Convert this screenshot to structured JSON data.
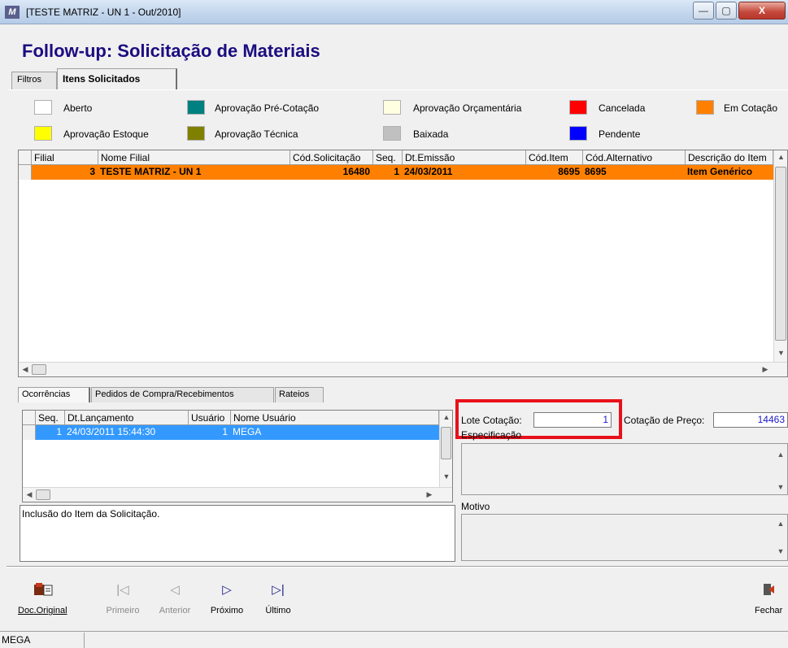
{
  "window": {
    "title": "[TESTE MATRIZ - UN 1 - Out/2010]",
    "app_icon": "app-logo-icon",
    "buttons": {
      "minimize": "—",
      "maximize": "▢",
      "close": "X"
    }
  },
  "page_title": "Follow-up: Solicitação de Materiais",
  "tabs": [
    {
      "label": "Filtros",
      "active": false
    },
    {
      "label": "Itens Solicitados",
      "active": true
    }
  ],
  "legend": [
    {
      "label": "Aberto",
      "color": "#ffffff"
    },
    {
      "label": "Aprovação Pré-Cotação",
      "color": "#008080"
    },
    {
      "label": "Aprovação Orçamentária",
      "color": "#ffffe1"
    },
    {
      "label": "Cancelada",
      "color": "#ff0000"
    },
    {
      "label": "Em Cotação",
      "color": "#ff8000"
    },
    {
      "label": "Aprovação Estoque",
      "color": "#ffff00"
    },
    {
      "label": "Aprovação Técnica",
      "color": "#808000"
    },
    {
      "label": "Baixada",
      "color": "#c0c0c0"
    },
    {
      "label": "Pendente",
      "color": "#0000ff"
    }
  ],
  "items_grid": {
    "columns": [
      "Filial",
      "Nome Filial",
      "Cód.Solicitação",
      "Seq.",
      "Dt.Emissão",
      "Cód.Item",
      "Cód.Alternativo",
      "Descrição do Item"
    ],
    "rows": [
      {
        "filial": "3",
        "nome_filial": "TESTE MATRIZ - UN 1",
        "cod_solicitacao": "16480",
        "seq": "1",
        "dt_emissao": "24/03/2011",
        "cod_item": "8695",
        "cod_alternativo": "8695",
        "descricao": "Item Genérico",
        "row_color": "#ff8000"
      }
    ]
  },
  "bottom_tabs": [
    {
      "label": "Ocorrências",
      "active": true
    },
    {
      "label": "Pedidos de Compra/Recebimentos",
      "active": false
    },
    {
      "label": "Rateios",
      "active": false
    }
  ],
  "occurrences_grid": {
    "columns": [
      "Seq.",
      "Dt.Lançamento",
      "Usuário",
      "Nome Usuário"
    ],
    "rows": [
      {
        "seq": "1",
        "dt_lancamento": "24/03/2011 15:44:30",
        "usuario": "1",
        "nome_usuario": "MEGA",
        "row_color": "#3399ff"
      }
    ]
  },
  "occurrence_note": "Inclusão do Item da Solicitação.",
  "lote_cotacao": {
    "label": "Lote Cotação:",
    "value": "1",
    "highlight_color": "#e8101a"
  },
  "cotacao_preco": {
    "label": "Cotação de Preço:",
    "value": "14463"
  },
  "especificacao_label": "Especificação",
  "motivo_label": "Motivo",
  "toolbar": {
    "doc_original": "Doc.Original",
    "primeiro": "Primeiro",
    "anterior": "Anterior",
    "proximo": "Próximo",
    "ultimo": "Último",
    "fechar": "Fechar"
  },
  "status_bar": {
    "text": "MEGA"
  }
}
